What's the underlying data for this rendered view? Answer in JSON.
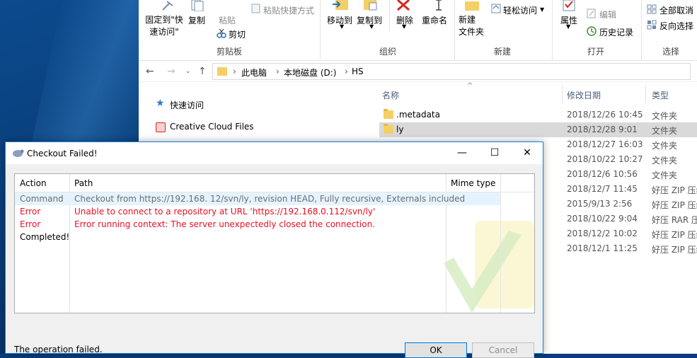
{
  "ribbon": {
    "pin_quick_access": "固定到\"快\n速访问\"",
    "copy": "复制",
    "paste": "粘贴",
    "paste_shortcut": "粘贴快捷方式",
    "cut": "剪切",
    "clipboard_group": "剪贴板",
    "move_to": "移动到",
    "copy_to": "复制到",
    "delete": "删除",
    "rename": "重命名",
    "organize_group": "组织",
    "new_folder": "新建\n文件夹",
    "easy_access": "轻松访问",
    "new_group": "新建",
    "properties": "属性",
    "edit": "编辑",
    "history": "历史记录",
    "open_group": "打开",
    "select_all_none": "全部取消",
    "invert_selection": "反向选择",
    "select_group": "选择"
  },
  "address": {
    "crumbs": [
      "此电脑",
      "本地磁盘 (D:)",
      "HS"
    ]
  },
  "navpane": {
    "quick_access": "快速访问",
    "creative_cloud": "Creative Cloud Files"
  },
  "filelist": {
    "headers": {
      "name": "名称",
      "modified": "修改日期",
      "type": "类型"
    },
    "rows": [
      {
        "name": ".metadata",
        "date": "2018/12/26 10:45",
        "type": "文件夹"
      },
      {
        "name": "ly",
        "date": "2018/12/28 9:01",
        "type": "文件夹"
      },
      {
        "name": "",
        "date": "2018/12/27 16:03",
        "type": "文件夹"
      },
      {
        "name": "",
        "date": "2018/10/22 10:27",
        "type": "文件夹"
      },
      {
        "name": "",
        "date": "2018/12/6 10:56",
        "type": "文件夹"
      },
      {
        "name": "",
        "date": "2018/12/7 11:45",
        "type": "好压 ZIP 压缩"
      },
      {
        "name": "",
        "date": "2015/9/13 2:56",
        "type": "好压 ZIP 压缩"
      },
      {
        "name": "",
        "date": "2018/10/22 9:04",
        "type": "好压 RAR 压缩"
      },
      {
        "name": "",
        "date": "2018/12/2 10:02",
        "type": "好压 ZIP 压缩"
      },
      {
        "name": "",
        "date": "2018/12/1 11:25",
        "type": "好压 ZIP 压缩"
      }
    ]
  },
  "dialog": {
    "title": "Checkout Failed!",
    "columns": {
      "action": "Action",
      "path": "Path",
      "mime": "Mime type"
    },
    "rows": [
      {
        "action": "Command",
        "path": "Checkout from https://192.168.   12/svn/ly, revision HEAD, Fully recursive, Externals included",
        "color": "#6d6d6d"
      },
      {
        "action": "Error",
        "path": "Unable to connect to a repository at URL 'https://192.168.0.112/svn/ly'",
        "color": "#e81123"
      },
      {
        "action": "Error",
        "path": "Error running context: The server unexpectedly closed the connection.",
        "color": "#e81123"
      },
      {
        "action": "Completed!",
        "path": "",
        "color": "#000000"
      }
    ],
    "status": "The operation failed.",
    "ok": "OK",
    "cancel": "Cancel"
  }
}
